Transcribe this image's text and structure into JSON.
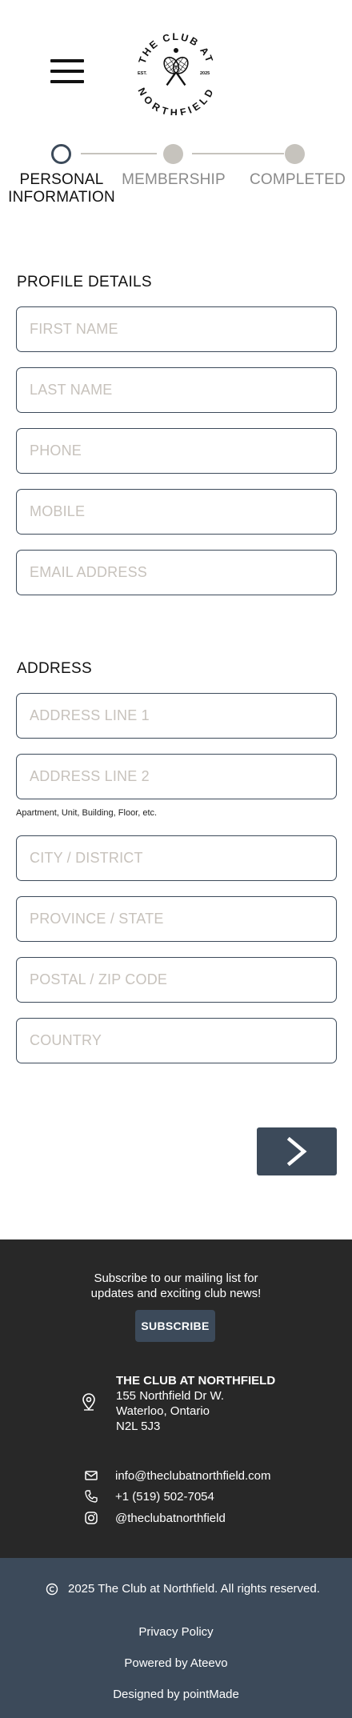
{
  "header": {
    "menu_icon": "hamburger-icon",
    "logo": {
      "top_text": "THE CLUB AT",
      "bottom_text": "NORTHFIELD",
      "left_text": "EST.",
      "right_text": "2025",
      "icon": "tennis-rackets-icon"
    }
  },
  "stepper": {
    "steps": [
      {
        "label_line1": "PERSONAL",
        "label_line2": "INFORMATION",
        "state": "active"
      },
      {
        "label_line1": "MEMBERSHIP",
        "label_line2": "",
        "state": "inactive"
      },
      {
        "label_line1": "COMPLETED",
        "label_line2": "",
        "state": "inactive"
      }
    ],
    "colors": {
      "active_border": "#3c4a5a",
      "inactive": "#c6c3bd"
    }
  },
  "profile": {
    "title": "PROFILE DETAILS",
    "fields": {
      "first_name": {
        "placeholder": "FIRST NAME",
        "value": ""
      },
      "last_name": {
        "placeholder": "LAST NAME",
        "value": ""
      },
      "phone": {
        "placeholder": "PHONE",
        "value": ""
      },
      "mobile": {
        "placeholder": "MOBILE",
        "value": ""
      },
      "email": {
        "placeholder": "EMAIL ADDRESS",
        "value": ""
      }
    }
  },
  "address": {
    "title": "ADDRESS",
    "fields": {
      "line1": {
        "placeholder": "ADDRESS LINE 1",
        "value": ""
      },
      "line2": {
        "placeholder": "ADDRESS LINE 2",
        "value": ""
      },
      "city": {
        "placeholder": "CITY / DISTRICT",
        "value": ""
      },
      "province": {
        "placeholder": "PROVINCE / STATE",
        "value": ""
      },
      "postal": {
        "placeholder": "POSTAL / ZIP CODE",
        "value": ""
      },
      "country": {
        "placeholder": "COUNTRY",
        "value": ""
      }
    },
    "line2_hint": "Apartment, Unit, Building, Floor, etc."
  },
  "next_button": {
    "icon": "chevron-right-icon"
  },
  "footer": {
    "subscribe_line1": "Subscribe to our mailing list for",
    "subscribe_line2": "updates and exciting club news!",
    "subscribe_label": "SUBSCRIBE",
    "club_name": "THE CLUB AT NORTHFIELD",
    "address_line1": "155 Northfield Dr W.",
    "address_line2": "Waterloo, Ontario",
    "address_line3": "N2L 5J3",
    "email": "info@theclubatnorthfield.com",
    "phone": "+1 (519) 502-7054",
    "instagram": "@theclubatnorthfield",
    "copyright": "2025 The Club at Northfield. All rights reserved.",
    "privacy": "Privacy Policy",
    "powered_by": "Powered by Ateevo",
    "designed_by": "Designed by pointMade",
    "colors": {
      "dark_bg": "#282828",
      "accent": "#3c4a5a"
    }
  }
}
